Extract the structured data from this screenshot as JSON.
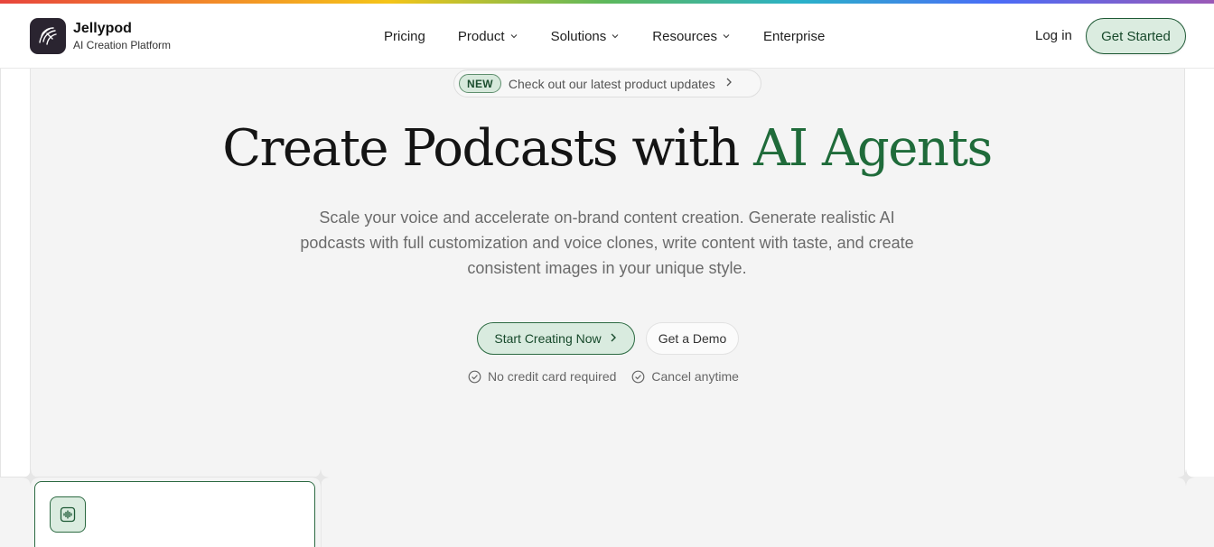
{
  "brand": {
    "name": "Jellypod",
    "tagline": "AI Creation Platform"
  },
  "nav": {
    "items": [
      {
        "label": "Pricing",
        "has_dropdown": false
      },
      {
        "label": "Product",
        "has_dropdown": true
      },
      {
        "label": "Solutions",
        "has_dropdown": true
      },
      {
        "label": "Resources",
        "has_dropdown": true
      },
      {
        "label": "Enterprise",
        "has_dropdown": false
      }
    ],
    "login_label": "Log in",
    "get_started_label": "Get Started"
  },
  "announcement": {
    "tag": "NEW",
    "text": "Check out our latest product updates"
  },
  "hero": {
    "title_main": "Create Podcasts with ",
    "title_accent": "AI Agents",
    "subtitle": "Scale your voice and accelerate on-brand content creation. Generate realistic AI podcasts with full customization and voice clones, write content with taste, and create consistent images in your unique style.",
    "cta_primary": "Start Creating Now",
    "cta_secondary": "Get a Demo",
    "checks": [
      "No credit card required",
      "Cancel anytime"
    ]
  },
  "colors": {
    "accent_green": "#1f6b3a",
    "button_bg": "#dbece0",
    "logo_bg": "#2a2430"
  },
  "icons": {
    "logo": "jellyfish-logo-icon",
    "card": "audio-waveform-icon"
  }
}
